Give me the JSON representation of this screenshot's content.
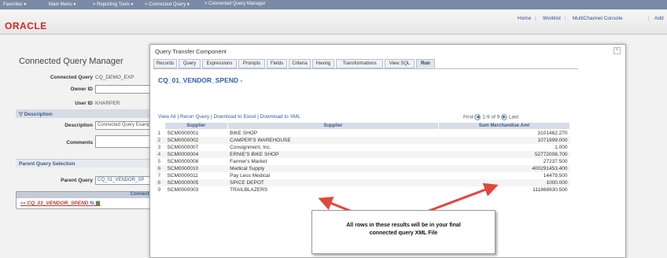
{
  "topnav": {
    "favorites": "Favorites ▾",
    "main_menu": "Main Menu ▾",
    "reporting_tools": "> Reporting Tools ▾",
    "connected_query": "> Connected Query ▾",
    "connected_query_manager": "> Connected Query Manager"
  },
  "header": {
    "logo": "ORACLE",
    "links": [
      "Home",
      "Worklist",
      "MultiChannel Console",
      "Add"
    ]
  },
  "page": {
    "title": "Connected Query Manager",
    "connected_query_label": "Connected Query",
    "connected_query_value": "CQ_DEMO_EXP",
    "owner_id_label": "Owner ID",
    "user_id_label": "User ID",
    "user_id_value": "KHARPER",
    "description_section": "▽ Description",
    "description_label": "Description",
    "description_value": "Connected Query Examp",
    "comments_label": "Comments",
    "parent_query_section": "Parent Query Selection",
    "parent_query_label": "Parent Query",
    "parent_query_value": "CQ_01_VENDOR_SP",
    "tree_header": "Connecte",
    "tree_item": "CQ_01_VENDOR_SPEND"
  },
  "modal": {
    "title": "Query Transfer Component",
    "close": "×",
    "tabs": [
      "Records",
      "Query",
      "Expressions",
      "Prompts",
      "Fields",
      "Criteria",
      "Having",
      "Transformations",
      "View SQL",
      "Run"
    ],
    "active_tab": "Run",
    "query_title": "CQ_01_VENDOR_SPEND -",
    "links": {
      "view_all": "View All",
      "rerun": "Rerun Query",
      "download_excel": "Download to Excel",
      "download_xml": "Download to XML",
      "separator": " | "
    },
    "pager": {
      "first": "First",
      "range": "1-9 of 9",
      "last": "Last"
    },
    "columns": [
      "Supplier",
      "Supplier",
      "Sum Merchandise Amt"
    ],
    "rows": [
      {
        "n": "1",
        "id": "SCM0000001",
        "name": "BIKE SHOP",
        "amt": "3101462.270"
      },
      {
        "n": "2",
        "id": "SCM0000002",
        "name": "CAMPER'S WAREHOUSE",
        "amt": "1071999.000"
      },
      {
        "n": "3",
        "id": "SCM0000007",
        "name": "Consignment, Inc.",
        "amt": "1.000"
      },
      {
        "n": "4",
        "id": "SCM0000004",
        "name": "ERNIE'S BIKE SHOP",
        "amt": "52772008.700"
      },
      {
        "n": "5",
        "id": "SCM0000008",
        "name": "Farmer's Market",
        "amt": "27237.500"
      },
      {
        "n": "6",
        "id": "SCM0000010",
        "name": "Medical Supply",
        "amt": "400291453.400"
      },
      {
        "n": "7",
        "id": "SCM0000011",
        "name": "Pay Less Medical",
        "amt": "14479.500"
      },
      {
        "n": "8",
        "id": "SCM0000005",
        "name": "SPICE DEPOT",
        "amt": "1000.000"
      },
      {
        "n": "9",
        "id": "SCM0000003",
        "name": "TRAILBLAZERS",
        "amt": "111868930.500"
      }
    ]
  },
  "callout": {
    "text_line1": "All rows in these results will be in your final",
    "text_line2": "connected query XML File"
  },
  "colors": {
    "arrow": "#e2463b",
    "link": "#2e5fa8",
    "oracle_red": "#e02020"
  }
}
